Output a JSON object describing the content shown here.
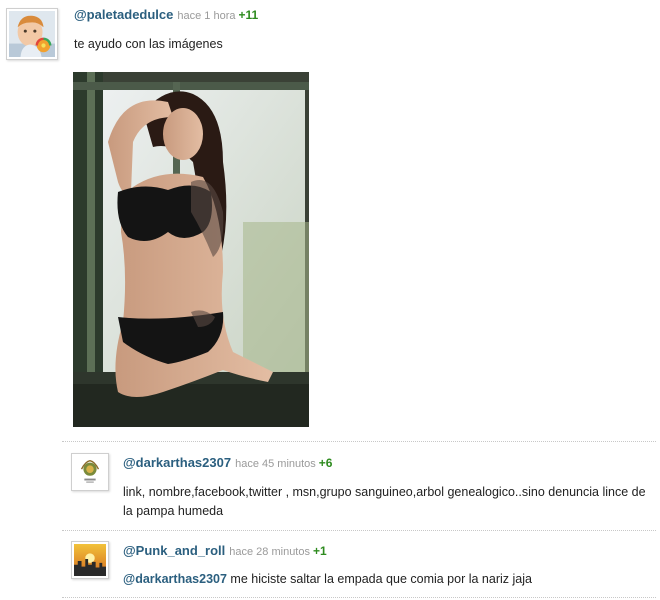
{
  "comments": [
    {
      "user": "@paletadedulce",
      "time": "hace 1 hora",
      "votes": "+11",
      "text": "te ayudo con las imágenes"
    },
    {
      "user": "@darkarthas2307",
      "time": "hace 45 minutos",
      "votes": "+6",
      "text": "link, nombre,facebook,twitter , msn,grupo sanguineo,arbol genealogico..sino denuncia lince de la pampa humeda"
    },
    {
      "user": "@Punk_and_roll",
      "time": "hace 28 minutos",
      "votes": "+1",
      "mention": "@darkarthas2307",
      "text": "me hiciste saltar la empada que comia por la nariz jaja"
    }
  ],
  "icons": {
    "avatar_1": "boy-with-lollipop-avatar",
    "avatar_2": "emblem-avatar",
    "avatar_3": "city-sunset-avatar"
  }
}
